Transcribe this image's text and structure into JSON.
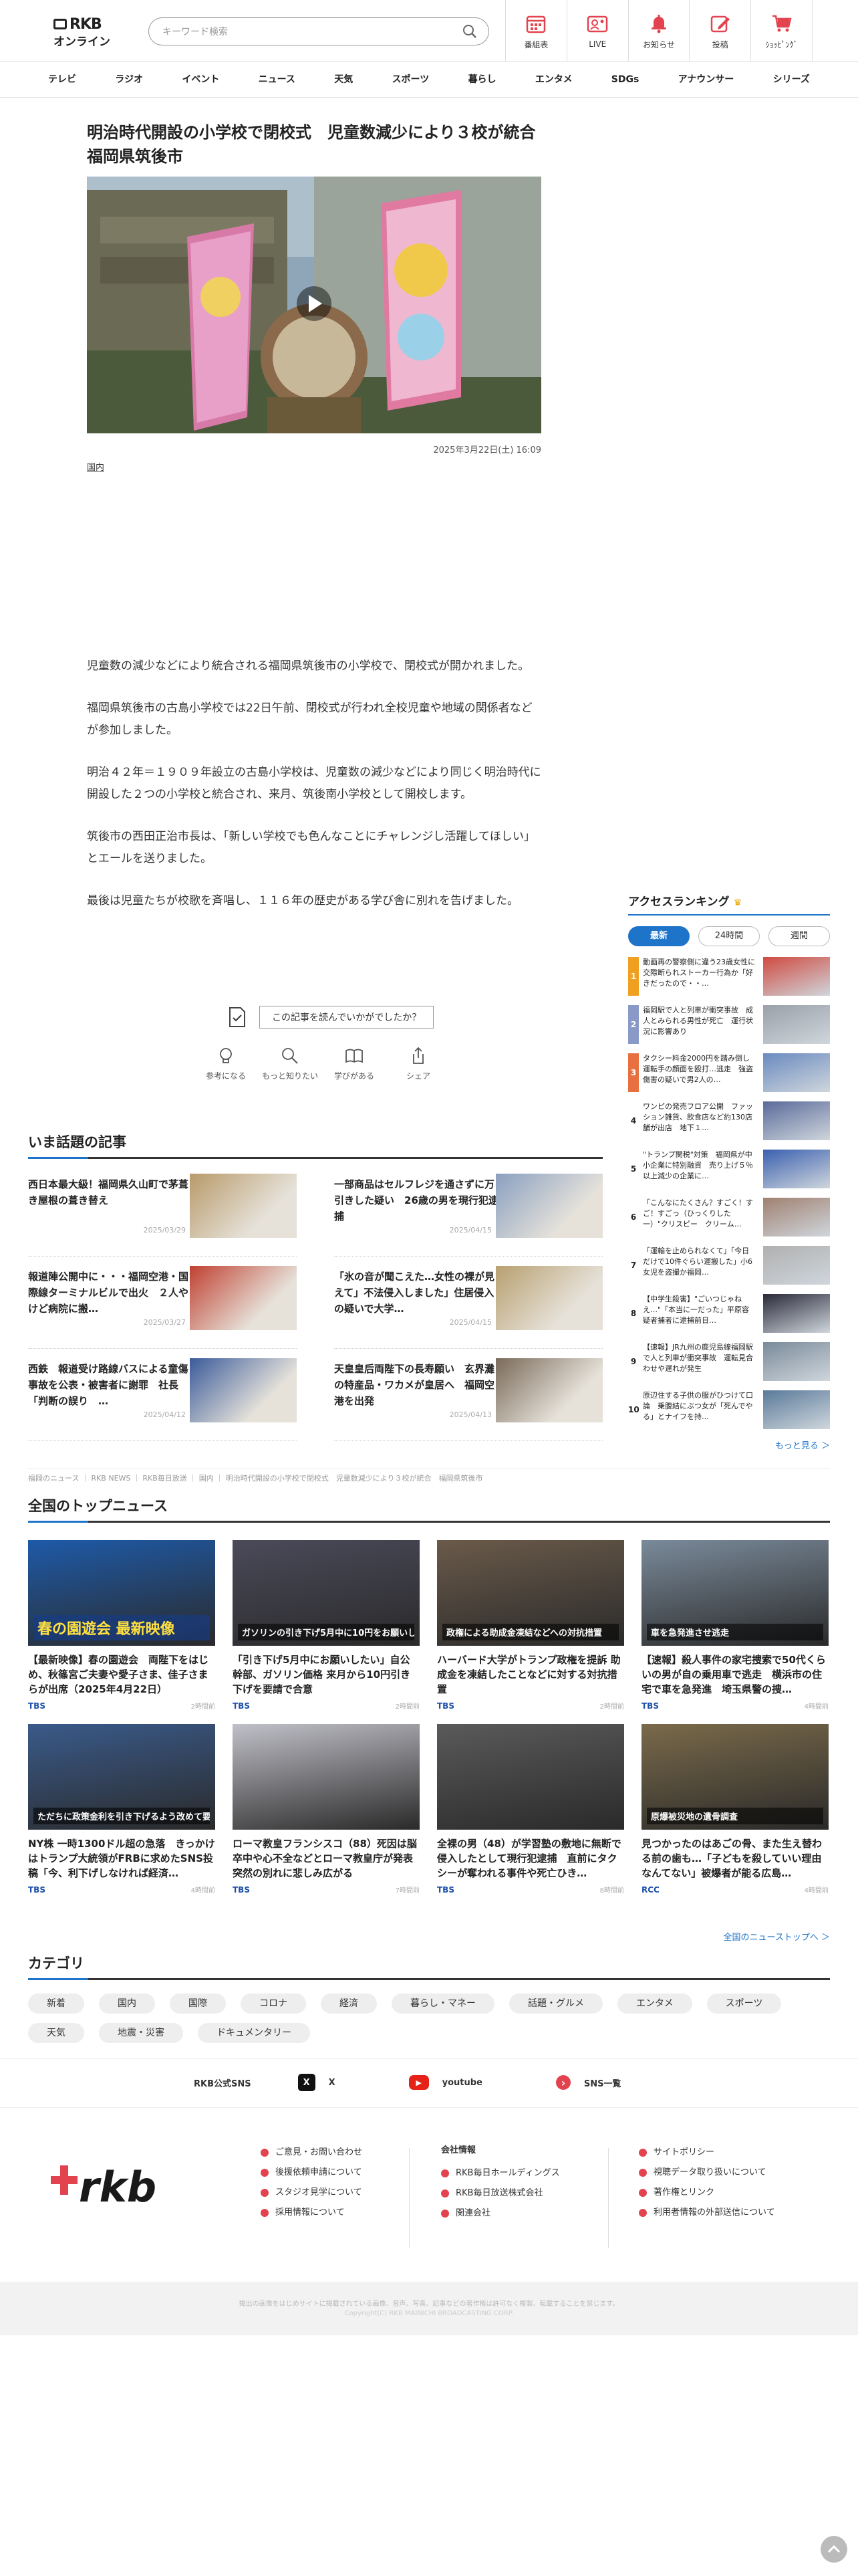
{
  "header": {
    "logo_top": "RKB",
    "logo_bottom": "オンライン",
    "search_placeholder": "キーワード検索",
    "nav": [
      {
        "label": "番組表",
        "icon": "calendar-icon"
      },
      {
        "label": "LIVE",
        "icon": "live-icon"
      },
      {
        "label": "お知らせ",
        "icon": "bell-icon"
      },
      {
        "label": "投稿",
        "icon": "edit-icon"
      },
      {
        "label": "ｼｮｯﾋﾟﾝｸﾞ",
        "icon": "cart-icon"
      }
    ]
  },
  "global_nav": [
    "テレビ",
    "ラジオ",
    "イベント",
    "ニュース",
    "天気",
    "スポーツ",
    "暮らし",
    "エンタメ",
    "SDGs",
    "アナウンサー",
    "シリーズ"
  ],
  "article": {
    "title": "明治時代開設の小学校で閉校式　児童数減少により３校が統合　福岡県筑後市",
    "date": "2025年3月22日(土) 16:09",
    "category": "国内",
    "paragraphs": [
      "児童数の減少などにより統合される福岡県筑後市の小学校で、閉校式が開かれました。",
      "福岡県筑後市の古島小学校では22日午前、閉校式が行われ全校児童や地域の関係者などが参加しました。",
      "明治４２年＝１９０９年設立の古島小学校は、児童数の減少などにより同じく明治時代に開設した２つの小学校と統合され、来月、筑後南小学校として開校します。",
      "筑後市の西田正治市長は、「新しい学校でも色んなことにチャレンジし活躍してほしい」とエールを送りました。",
      "最後は児童たちが校歌を斉唱し、１１６年の歴史がある学び舎に別れを告げました。"
    ],
    "feedback_question": "この記事を読んでいかがでしたか？",
    "feedback_buttons": [
      {
        "label": "参考になる",
        "icon": "bulb-icon"
      },
      {
        "label": "もっと知りたい",
        "icon": "magnifier-icon"
      },
      {
        "label": "学びがある",
        "icon": "book-icon"
      },
      {
        "label": "シェア",
        "icon": "share-icon"
      }
    ]
  },
  "trending": {
    "heading": "いま話題の記事",
    "items": [
      {
        "title": "西日本最大級！福岡県久山町で茅葺き屋根の葺き替え",
        "date": "2025/03/29",
        "color": "#b89a6a"
      },
      {
        "title": "一部商品はセルフレジを通さずに万引きした疑い　26歳の男を現行犯逮捕",
        "date": "2025/04/15",
        "color": "#8aa0c0"
      },
      {
        "title": "報道陣公開中に・・・福岡空港・国際線ターミナルビルで出火　２人やけど病院に搬…",
        "date": "2025/03/27",
        "color": "#c04030"
      },
      {
        "title": "「氷の音が聞こえた…女性の裸が見えて」不法侵入しました」住居侵入の疑いで大学…",
        "date": "2025/04/15",
        "color": "#b8a070"
      },
      {
        "title": "西鉄　報道受け路線バスによる童傷事故を公表・被害者に謝罪　社長「判断の誤り　…",
        "date": "2025/04/12",
        "color": "#3a5a9a"
      },
      {
        "title": "天皇皇后両陛下の長寿願い　玄界灘の特産品・ワカメが皇居へ　福岡空港を出発",
        "date": "2025/04/13",
        "color": "#7a6a5a"
      }
    ]
  },
  "ranking": {
    "heading": "アクセスランキング",
    "tabs": [
      "最新",
      "24時間",
      "週間"
    ],
    "items": [
      {
        "rank": "1",
        "title": "動画再の警察側に違う23歳女性に交際断られストーカー行為か「好きだったので・・…",
        "color": "#f0a020",
        "img": "#d04a40"
      },
      {
        "title": "福岡駅で人と列車が衝突事故　成人とみられる男性が死亡　運行状況に影響あり",
        "rank": "2",
        "color": "#8a9ac8",
        "img": "#9aa0a8"
      },
      {
        "rank": "3",
        "title": "タクシー料金2000円を踏み倒し運転手の顔面を殴打…逃走　強盗傷害の疑いで男2人の…",
        "color": "#e87040",
        "img": "#6a8ac0"
      },
      {
        "rank": "4",
        "title": "ワンピの発売フロア公開　ファッション雑貨、飲食店など約130店舗が出店　地下１…",
        "color": "#ffffff",
        "img": "#5a6a9a"
      },
      {
        "rank": "5",
        "title": "\"トランプ関税\"対策　福岡県が中小企業に特別融資　売り上げ５％以上減少の企業に…",
        "color": "#ffffff",
        "img": "#3a60b0"
      },
      {
        "rank": "6",
        "title": "「こんなにたくさん？すごく！すご！すごっ（ひっくりした一）\"クリスピー　クリーム…",
        "color": "#ffffff",
        "img": "#a08070"
      },
      {
        "rank": "7",
        "title": "「運輸を止められなくて」「今日だけで10件ぐらい運搬した」小6女児を盗撮か福岡…",
        "color": "#ffffff",
        "img": "#b0b0b0"
      },
      {
        "rank": "8",
        "title": "【中学生殺害】\"ごいつじゃねえ…\"「本当に一だった」平原容疑者捕者に逮捕前日…",
        "color": "#ffffff",
        "img": "#2a2a3a"
      },
      {
        "rank": "9",
        "title": "【速報】JR九州の鹿児島線福岡駅で人と列車が衝突事故　運転見合わせや遅れが発生",
        "color": "#ffffff",
        "img": "#7a8a9a"
      },
      {
        "rank": "10",
        "title": "原辺住する子供の服がひつけて口論　乗腹結にぶつ女が「死んでやる」とナイフを持…",
        "color": "#ffffff",
        "img": "#5a7a9a"
      }
    ],
    "more": "もっと見る ＞"
  },
  "breadcrumb": "福岡のニュース ｜ RKB NEWS ｜ RKB毎日放送 ｜ 国内 ｜ 明治時代開設の小学校で閉校式　児童数減少により３校が統合　福岡県筑後市",
  "top_news": {
    "heading": "全国のトップニュース",
    "items": [
      {
        "title": "【最新映像】春の園遊会　両陛下をはじめ、秋篠宮ご夫妻や愛子さま、佳子さまらが出席（2025年4月22日）",
        "src": "TBS",
        "ago": "2時間前",
        "color": "#1e5aa8",
        "caption": "春の園遊会 最新映像"
      },
      {
        "title": "「引き下げ5月中にお願いしたい」自公幹部、ガソリン価格 来月から10円引き下げを要請で合意",
        "src": "TBS",
        "ago": "2時間前",
        "color": "#4a4a5a",
        "caption": "ガソリンの引き下げ5月中に10円をお願いしたい"
      },
      {
        "title": "ハーバード大学がトランプ政権を提訴 助成金を凍結したことなどに対する対抗措置",
        "src": "TBS",
        "ago": "2時間前",
        "color": "#6a5a4a",
        "caption": "政権による助成金凍結などへの対抗措置"
      },
      {
        "title": "【速報】殺人事件の家宅捜索で50代くらいの男が自の乗用車で逃走　横浜市の住宅で車を急発進　埼玉県警の捜…",
        "src": "TBS",
        "ago": "4時間前",
        "color": "#7a8a9a",
        "caption": "車を急発進させ逃走"
      },
      {
        "title": "NY株 一時1300ドル超の急落　きっかけはトランプ大統領がFRBに求めたSNS投稿「今、利下げしなければ経済…",
        "src": "TBS",
        "ago": "4時間前",
        "color": "#3a5a8a",
        "caption": "ただちに政策金利を引き下げるよう改めて要求"
      },
      {
        "title": "ローマ教皇フランシスコ（88）死因は脳卒中や心不全などとローマ教皇庁が発表　突然の別れに悲しみ広がる",
        "src": "TBS",
        "ago": "7時間前",
        "color": "#c0c0c8",
        "caption": ""
      },
      {
        "title": "全裸の男（48）が学習塾の敷地に無断で侵入したとして現行犯逮捕　直前にタクシーが奪われる事件や死亡ひき…",
        "src": "TBS",
        "ago": "8時間前",
        "color": "#5a5a5a",
        "caption": ""
      },
      {
        "title": "見つかったのはあごの骨、また生え替わる前の歯も…「子どもを殺していい理由なんてない」被爆者が能る広島…",
        "src": "RCC",
        "ago": "4時間前",
        "color": "#7a6a4a",
        "caption": "原爆被災地の遺骨調査"
      }
    ],
    "more": "全国のニューストップへ ＞"
  },
  "category": {
    "heading": "カテゴリ",
    "items": [
      "新着",
      "国内",
      "国際",
      "コロナ",
      "経済",
      "暮らし・マネー",
      "話題・グルメ",
      "エンタメ",
      "スポーツ",
      "天気",
      "地震・災害",
      "ドキュメンタリー"
    ]
  },
  "sns": {
    "label": "RKB公式SNS",
    "items": [
      {
        "name": "X",
        "icon": "x-icon",
        "color": "#111111",
        "glyph": "X"
      },
      {
        "name": "youtube",
        "icon": "youtube-icon",
        "color": "#e62117",
        "glyph": "▶"
      },
      {
        "name": "SNS一覧",
        "icon": "sns-list-icon",
        "color": "#e3424f",
        "glyph": "›"
      }
    ]
  },
  "footer": {
    "col1": [
      "ご意見・お問い合わせ",
      "後援依頼申請について",
      "スタジオ見学について",
      "採用情報について"
    ],
    "col2_title": "会社情報",
    "col2": [
      "RKB毎日ホールディングス",
      "RKB毎日放送株式会社",
      "関連会社"
    ],
    "col3": [
      "サイトポリシー",
      "視聴データ取り扱いについて",
      "著作権とリンク",
      "利用者情報の外部送信について"
    ],
    "notice": "掲出の画像をはじめサイトに掲載されている画像、音声、写真、記事などの著作権は許可なく複製、転載することを禁じます。",
    "copyright": "Copyright(C) RKB MAINICHI BROADCASTING CORP."
  },
  "colors": {
    "accent": "#1e74c8",
    "brand": "#e3424f"
  }
}
